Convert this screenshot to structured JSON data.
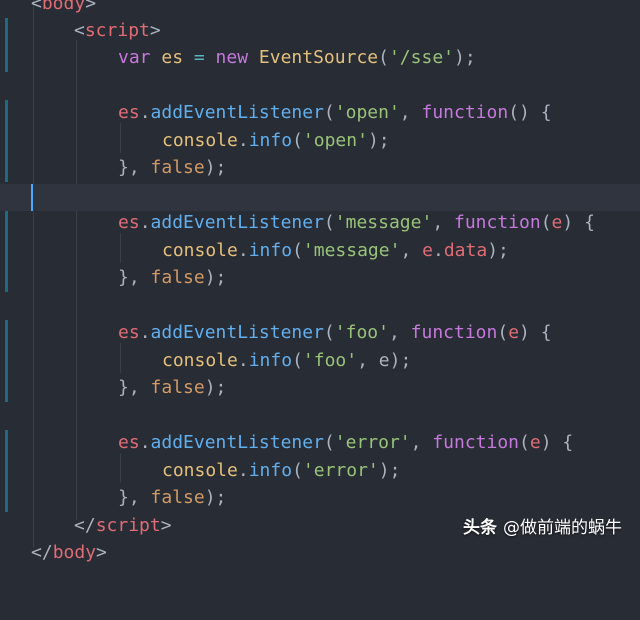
{
  "editor": {
    "lines": {
      "l0": {
        "t1": "<",
        "t2": "body",
        "t3": ">"
      },
      "l1": {
        "t1": "<",
        "t2": "script",
        "t3": ">"
      },
      "l2": {
        "t1": "var",
        "t2": " es ",
        "t3": "=",
        "t4": " new ",
        "t5": "EventSource",
        "t6": "(",
        "t7": "'/sse'",
        "t8": ");"
      },
      "l4": {
        "t1": "es",
        "t2": ".",
        "t3": "addEventListener",
        "t4": "(",
        "t5": "'open'",
        "t6": ", ",
        "t7": "function",
        "t8": "() {"
      },
      "l5": {
        "t1": "console",
        "t2": ".",
        "t3": "info",
        "t4": "(",
        "t5": "'open'",
        "t6": ");"
      },
      "l6": {
        "t1": "}, ",
        "t2": "false",
        "t3": ");"
      },
      "l8": {
        "t1": "es",
        "t2": ".",
        "t3": "addEventListener",
        "t4": "(",
        "t5": "'message'",
        "t6": ", ",
        "t7": "function",
        "t8": "(",
        "t9": "e",
        "t10": ") {"
      },
      "l9": {
        "t1": "console",
        "t2": ".",
        "t3": "info",
        "t4": "(",
        "t5": "'message'",
        "t6": ", ",
        "t7": "e",
        "t8": ".",
        "t9": "data",
        "t10": ");"
      },
      "l10": {
        "t1": "}, ",
        "t2": "false",
        "t3": ");"
      },
      "l12": {
        "t1": "es",
        "t2": ".",
        "t3": "addEventListener",
        "t4": "(",
        "t5": "'foo'",
        "t6": ", ",
        "t7": "function",
        "t8": "(",
        "t9": "e",
        "t10": ") {"
      },
      "l13": {
        "t1": "console",
        "t2": ".",
        "t3": "info",
        "t4": "(",
        "t5": "'foo'",
        "t6": ", e);"
      },
      "l14": {
        "t1": "}, ",
        "t2": "false",
        "t3": ");"
      },
      "l16": {
        "t1": "es",
        "t2": ".",
        "t3": "addEventListener",
        "t4": "(",
        "t5": "'error'",
        "t6": ", ",
        "t7": "function",
        "t8": "(",
        "t9": "e",
        "t10": ") {"
      },
      "l17": {
        "t1": "console",
        "t2": ".",
        "t3": "info",
        "t4": "(",
        "t5": "'error'",
        "t6": ");"
      },
      "l18": {
        "t1": "}, ",
        "t2": "false",
        "t3": ");"
      },
      "l19": {
        "t1": "</",
        "t2": "script",
        "t3": ">"
      },
      "l20": {
        "t1": "</",
        "t2": "body",
        "t3": ">"
      }
    }
  },
  "watermark": {
    "brand": "头条",
    "handle": "@做前端的蜗牛"
  },
  "colors": {
    "background": "#282c34",
    "tag": "#e06c75",
    "keyword": "#c678dd",
    "string": "#98c379",
    "function": "#61afef",
    "boolean": "#d19a66",
    "marker": "#1e6a84"
  }
}
